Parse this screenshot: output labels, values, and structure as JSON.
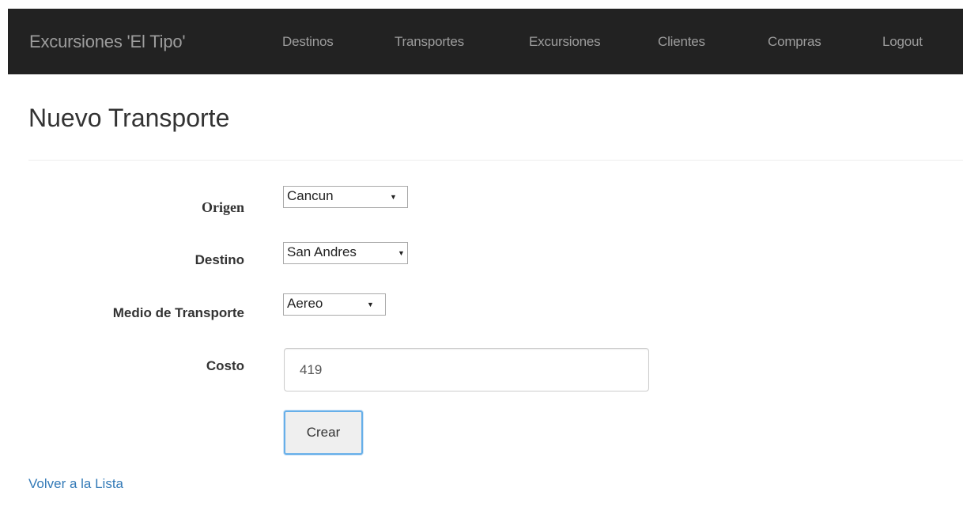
{
  "navbar": {
    "brand": "Excursiones 'El Tipo'",
    "links": [
      "Destinos",
      "Transportes",
      "Excursiones",
      "Clientes",
      "Compras",
      "Logout"
    ]
  },
  "page_title": "Nuevo Transporte",
  "form": {
    "origen": {
      "label": "Origen",
      "selected": "Cancun"
    },
    "destino": {
      "label": "Destino",
      "selected": "San Andres"
    },
    "medio": {
      "label": "Medio de Transporte",
      "selected": "Aereo"
    },
    "costo": {
      "label": "Costo",
      "value": "419"
    },
    "submit_label": "Crear"
  },
  "back_link": "Volver a la Lista"
}
